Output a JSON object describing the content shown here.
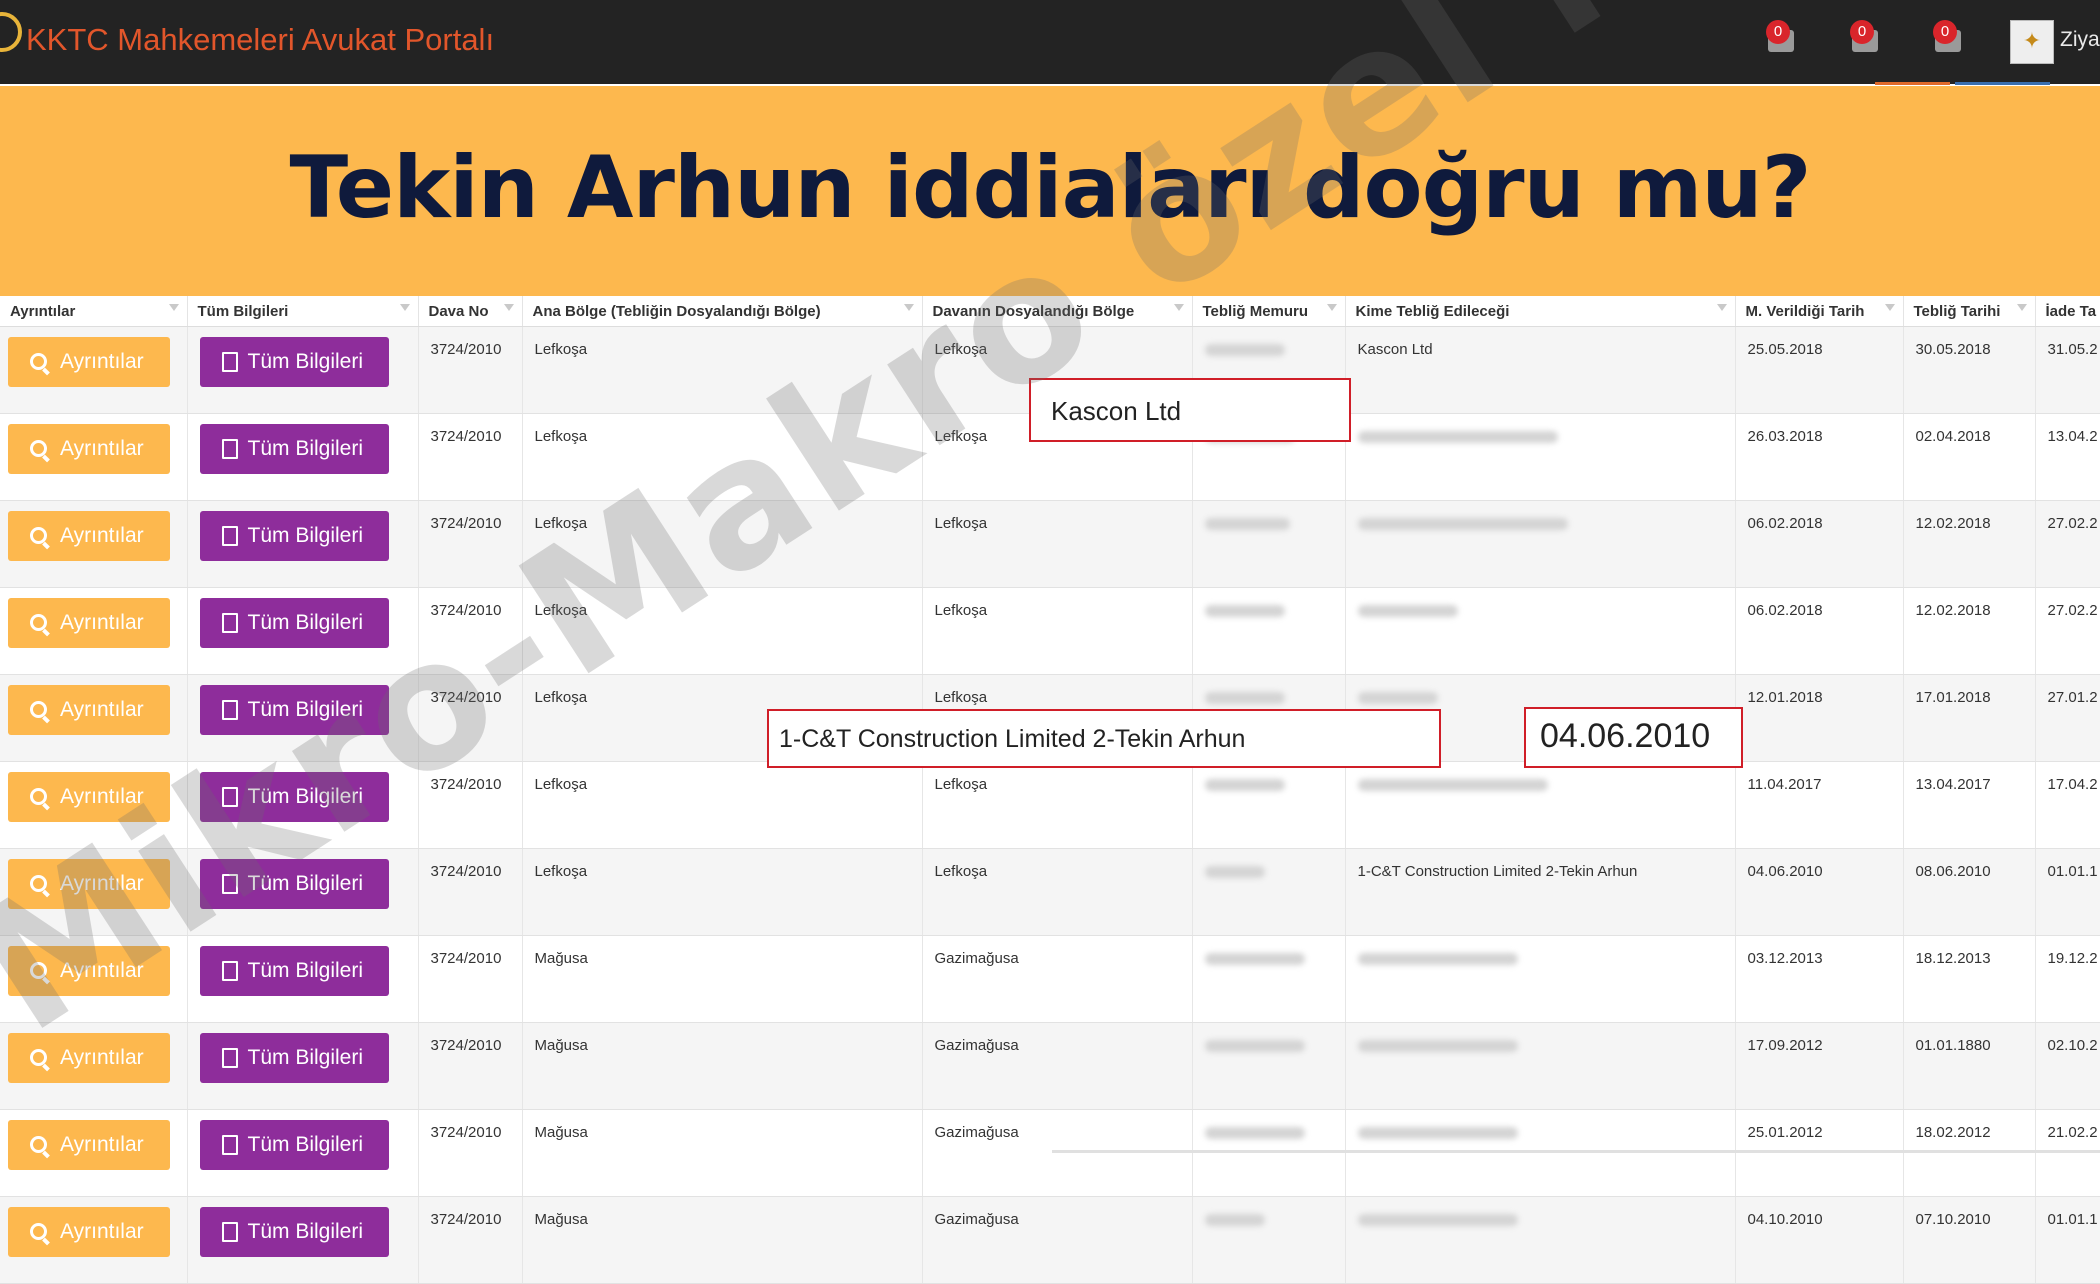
{
  "header": {
    "portal_title": "KKTC Mahkemeleri Avukat Portalı",
    "notifications": [
      "0",
      "0",
      "0"
    ],
    "user_name": "Ziyar"
  },
  "banner": {
    "headline": "Tekin Arhun iddiaları doğru mu?"
  },
  "table": {
    "columns": [
      "Ayrıntılar",
      "Tüm Bilgileri",
      "Dava No",
      "Ana Bölge (Tebliğin Dosyalandığı Bölge)",
      "Davanın Dosyalandığı Bölge",
      "Tebliğ Memuru",
      "Kime Tebliğ Edileceği",
      "M. Verildiği Tarih",
      "Tebliğ Tarihi",
      "İade Ta"
    ],
    "details_label": "Ayrıntılar",
    "all_info_label": "Tüm Bilgileri",
    "rows": [
      {
        "dava": "3724/2010",
        "ana": "Lefkoşa",
        "davanin": "Lefkoşa",
        "kime": "Kascon Ltd",
        "m_tarih": "25.05.2018",
        "teblig": "30.05.2018",
        "iade": "31.05.2"
      },
      {
        "dava": "3724/2010",
        "ana": "Lefkoşa",
        "davanin": "Lefkoşa",
        "kime": "",
        "m_tarih": "26.03.2018",
        "teblig": "02.04.2018",
        "iade": "13.04.2"
      },
      {
        "dava": "3724/2010",
        "ana": "Lefkoşa",
        "davanin": "Lefkoşa",
        "kime": "",
        "m_tarih": "06.02.2018",
        "teblig": "12.02.2018",
        "iade": "27.02.2"
      },
      {
        "dava": "3724/2010",
        "ana": "Lefkoşa",
        "davanin": "Lefkoşa",
        "kime": "",
        "m_tarih": "06.02.2018",
        "teblig": "12.02.2018",
        "iade": "27.02.2"
      },
      {
        "dava": "3724/2010",
        "ana": "Lefkoşa",
        "davanin": "Lefkoşa",
        "kime": "",
        "m_tarih": "12.01.2018",
        "teblig": "17.01.2018",
        "iade": "27.01.2"
      },
      {
        "dava": "3724/2010",
        "ana": "Lefkoşa",
        "davanin": "Lefkoşa",
        "kime": "",
        "m_tarih": "11.04.2017",
        "teblig": "13.04.2017",
        "iade": "17.04.2"
      },
      {
        "dava": "3724/2010",
        "ana": "Lefkoşa",
        "davanin": "Lefkoşa",
        "kime": "1-C&T Construction Limited 2-Tekin Arhun",
        "m_tarih": "04.06.2010",
        "teblig": "08.06.2010",
        "iade": "01.01.1"
      },
      {
        "dava": "3724/2010",
        "ana": "Mağusa",
        "davanin": "Gazimağusa",
        "kime": "",
        "m_tarih": "03.12.2013",
        "teblig": "18.12.2013",
        "iade": "19.12.2"
      },
      {
        "dava": "3724/2010",
        "ana": "Mağusa",
        "davanin": "Gazimağusa",
        "kime": "",
        "m_tarih": "17.09.2012",
        "teblig": "01.01.1880",
        "iade": "02.10.2"
      },
      {
        "dava": "3724/2010",
        "ana": "Mağusa",
        "davanin": "Gazimağusa",
        "kime": "",
        "m_tarih": "25.01.2012",
        "teblig": "18.02.2012",
        "iade": "21.02.2"
      },
      {
        "dava": "3724/2010",
        "ana": "Mağusa",
        "davanin": "Gazimağusa",
        "kime": "",
        "m_tarih": "04.10.2010",
        "teblig": "07.10.2010",
        "iade": "01.01.1"
      }
    ]
  },
  "callouts": {
    "company": "Kascon Ltd",
    "parties": "1-C&T Construction Limited 2-Tekin Arhun",
    "date": "04.06.2010"
  },
  "watermark": "Mikro-Makro özel haber",
  "colors": {
    "accent_orange": "#fdb84e",
    "button_purple": "#8e2d9b",
    "callout_red": "#d01e28",
    "headline_navy": "#0f1a3c"
  }
}
